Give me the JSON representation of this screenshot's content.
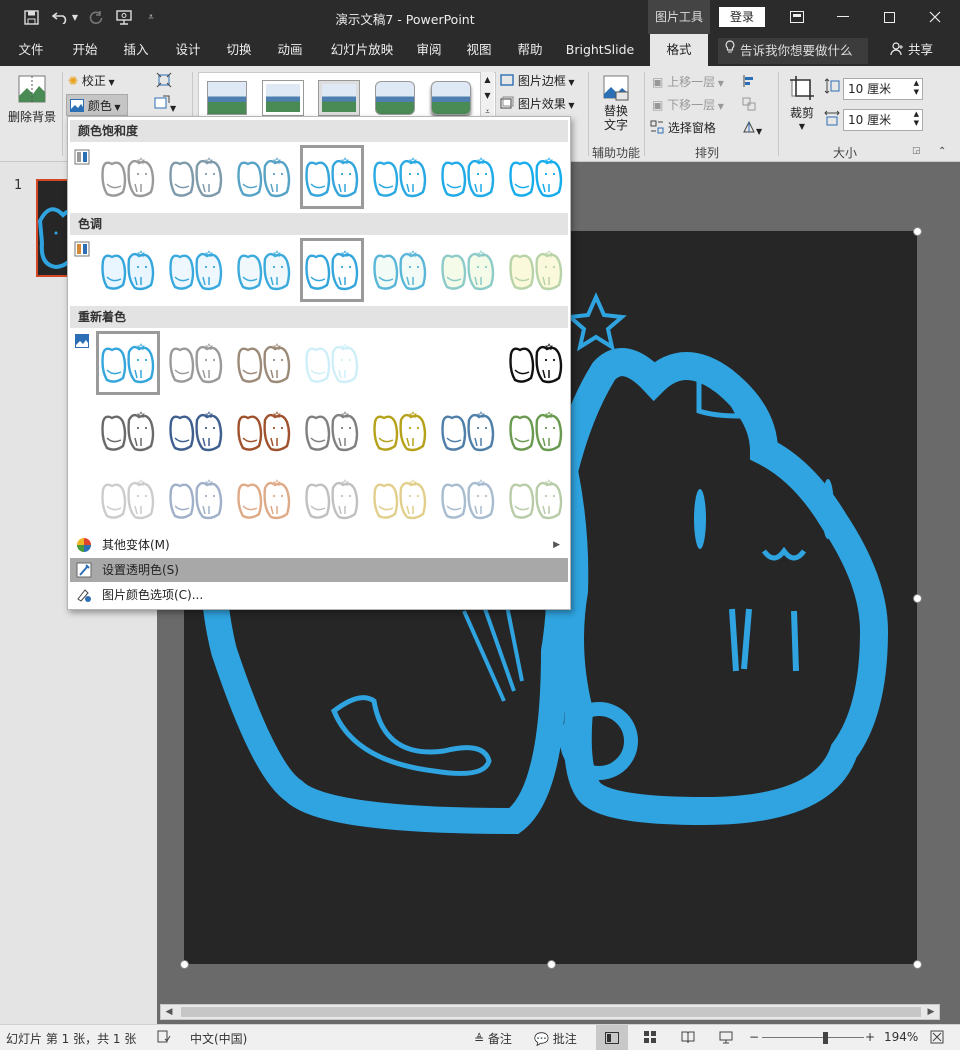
{
  "app": {
    "title": "演示文稿7 - PowerPoint",
    "tools_label": "图片工具",
    "login": "登录"
  },
  "tabs": [
    "文件",
    "开始",
    "插入",
    "设计",
    "切换",
    "动画",
    "幻灯片放映",
    "审阅",
    "视图",
    "帮助",
    "BrightSlide",
    "格式"
  ],
  "tell_me": "告诉我你想要做什么",
  "share": "共享",
  "ribbon": {
    "remove_bg": "删除背景",
    "corrections": "校正",
    "color": "颜色",
    "picture_border": "图片边框",
    "picture_effects": "图片效果",
    "alt_text_line1": "替换",
    "alt_text_line2": "文字",
    "accessibility_label": "辅助功能",
    "bring_forward": "上移一层",
    "send_backward": "下移一层",
    "selection_pane": "选择窗格",
    "arrange_label": "排列",
    "crop": "裁剪",
    "height_value": "10 厘米",
    "width_value": "10 厘米",
    "size_label": "大小"
  },
  "dropdown": {
    "saturation_title": "颜色饱和度",
    "tone_title": "色调",
    "recolor_title": "重新着色",
    "more_variations": "其他变体(M)",
    "set_transparent": "设置透明色(S)",
    "color_options": "图片颜色选项(C)...",
    "saturation_colors": [
      "#9a9a9a",
      "#7f9aaa",
      "#56a3c6",
      "#35a6dc",
      "#2aa9e3",
      "#20abe8",
      "#17aded"
    ],
    "tone_colors": [
      "#35a6dc",
      "#3aaade",
      "#3cabdc",
      "#35a6dc",
      "#5ab7d8",
      "#8ccbc8",
      "#b9d3a8"
    ],
    "tone_fills": [
      "#eaf6ff",
      "#eef7fd",
      "#f0f8fb",
      "#ffffff",
      "#f3fbf6",
      "#f5fbe9",
      "#fbf9dc"
    ],
    "recolor_row1": [
      "#35a6dc",
      "#9a9a9a",
      "#9c8a78",
      "#cfeff8",
      "none",
      "none",
      "#111111"
    ],
    "recolor_row2": [
      "#6a6a6a",
      "#3f5f8f",
      "#a0522d",
      "#808080",
      "#b5a21a",
      "#4f7fa8",
      "#6a9a50"
    ],
    "recolor_row3": [
      "#cccccc",
      "#9fb0c8",
      "#dfaa88",
      "#c0c0c0",
      "#e2cf8c",
      "#a8bcd0",
      "#b8cca8"
    ]
  },
  "status": {
    "slide_info": "幻灯片 第 1 张，共 1 张",
    "language": "中文(中国)",
    "notes": "备注",
    "comments": "批注",
    "zoom": "194%"
  },
  "thumbnail": {
    "slide_number": "1"
  },
  "colors": {
    "accent": "#2fa4e0",
    "brand_orange": "#d24726",
    "titlebar": "#2b2b2b"
  }
}
